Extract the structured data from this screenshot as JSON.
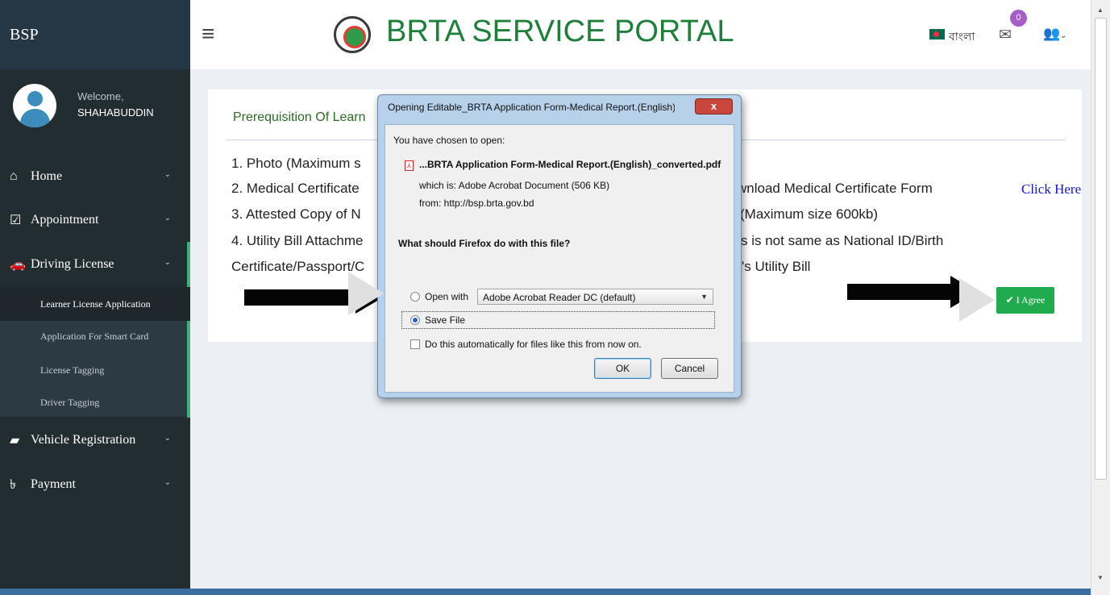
{
  "sidebar": {
    "brand": "BSP",
    "welcome": "Welcome,",
    "username": "SHAHABUDDIN",
    "nav": {
      "home": "Home",
      "appointment": "Appointment",
      "driving_license": "Driving License",
      "vehicle_registration": "Vehicle Registration",
      "payment": "Payment"
    },
    "sub": {
      "learner": "Learner License Application",
      "smartcard": "Application For Smart Card",
      "license_tagging": "License Tagging",
      "driver_tagging": "Driver Tagging"
    }
  },
  "header": {
    "title": "BRTA SERVICE PORTAL",
    "language": "বাংলা",
    "mail_count": "0"
  },
  "content": {
    "title": "Prerequisition Of Learn",
    "l1": "1. Photo (Maximum s",
    "l2a": "2. Medical Certificate",
    "l2b": "wnload Medical Certificate Form",
    "click_here": "Click Here",
    "l3a": "3. Attested Copy of N",
    "l3b": "(Maximum size 600kb)",
    "l4a": "4. Utility Bill Attachme",
    "l4b": "s is not same as National ID/Birth",
    "l5a": "Certificate/Passport/C",
    "l5b": "'s Utility Bill",
    "agree": "✔ I Agree"
  },
  "dialog": {
    "title": "Opening Editable_BRTA Application Form-Medical Report.(English)_co...",
    "close": "x",
    "chosen": "You have chosen to open:",
    "filename": "...BRTA Application Form-Medical Report.(English)_converted.pdf",
    "which_is": "which is:  Adobe Acrobat Document (506 KB)",
    "from": "from:  http://bsp.brta.gov.bd",
    "question": "What should Firefox do with this file?",
    "open_with": "Open with",
    "open_app": "Adobe Acrobat Reader DC  (default)",
    "save_file": "Save File",
    "auto": "Do this automatically for files like this from now on.",
    "ok": "OK",
    "cancel": "Cancel"
  },
  "colors": {
    "sidebar": "#222d32",
    "title_green": "#1e7f3b",
    "agree_green": "#1fab4e",
    "link_blue": "#1212dd"
  }
}
